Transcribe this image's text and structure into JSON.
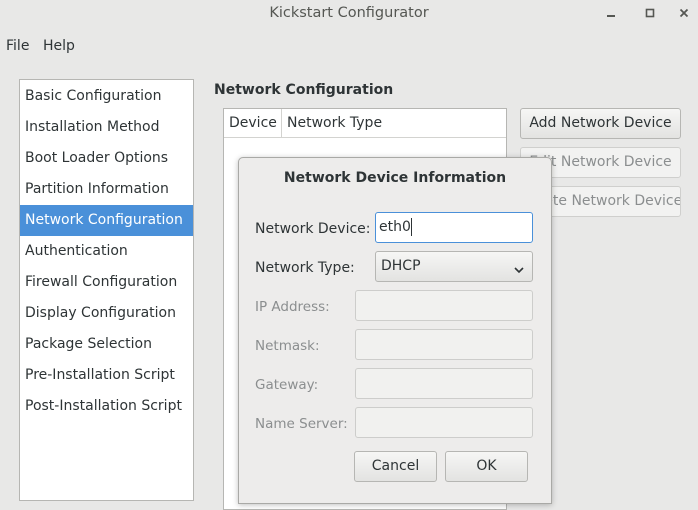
{
  "window": {
    "title": "Kickstart Configurator",
    "controls": [
      "minimize-icon",
      "maximize-icon",
      "close-icon"
    ]
  },
  "menubar": {
    "file": "File",
    "help": "Help"
  },
  "sidebar": {
    "items": [
      {
        "label": "Basic Configuration"
      },
      {
        "label": "Installation Method"
      },
      {
        "label": "Boot Loader Options"
      },
      {
        "label": "Partition Information"
      },
      {
        "label": "Network Configuration"
      },
      {
        "label": "Authentication"
      },
      {
        "label": "Firewall Configuration"
      },
      {
        "label": "Display Configuration"
      },
      {
        "label": "Package Selection"
      },
      {
        "label": "Pre-Installation Script"
      },
      {
        "label": "Post-Installation Script"
      }
    ],
    "selected": "Network Configuration"
  },
  "main": {
    "section_title": "Network Configuration",
    "table": {
      "columns": [
        "Device",
        "Network Type"
      ],
      "rows": []
    },
    "buttons": {
      "add": "Add Network Device",
      "edit": "Edit Network Device",
      "delete": "Delete Network Device"
    }
  },
  "dialog": {
    "title": "Network Device Information",
    "device_label": "Network Device:",
    "device_value": "eth0",
    "type_label": "Network Type:",
    "type_value": "DHCP",
    "ip_label": "IP Address:",
    "ip_value": "",
    "netmask_label": "Netmask:",
    "netmask_value": "",
    "gateway_label": "Gateway:",
    "gateway_value": "",
    "nameserver_label": "Name Server:",
    "nameserver_value": "",
    "cancel": "Cancel",
    "ok": "OK"
  },
  "colors": {
    "accent": "#4a90d9",
    "window_bg": "#e8e8e7",
    "text": "#2e3436",
    "disabled_text": "#8b8e8f"
  }
}
